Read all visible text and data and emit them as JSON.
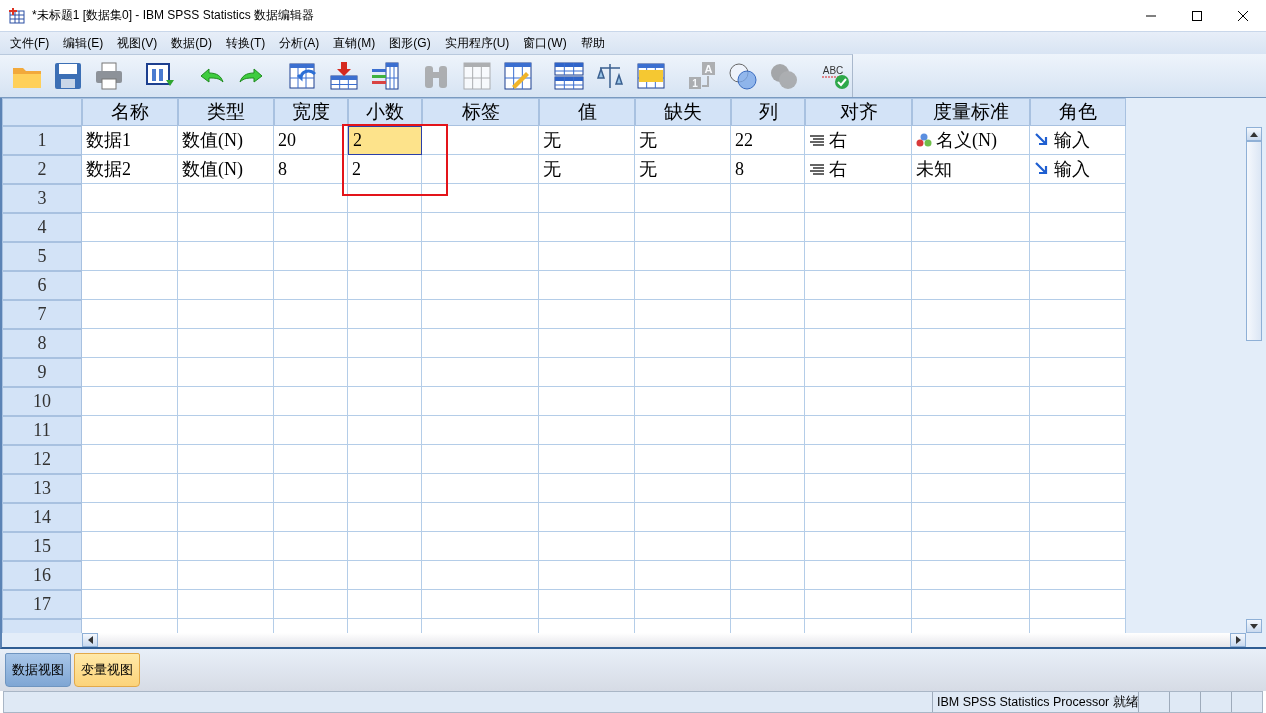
{
  "window": {
    "title": "*未标题1 [数据集0] - IBM SPSS Statistics 数据编辑器"
  },
  "menu": [
    "文件(F)",
    "编辑(E)",
    "视图(V)",
    "数据(D)",
    "转换(T)",
    "分析(A)",
    "直销(M)",
    "图形(G)",
    "实用程序(U)",
    "窗口(W)",
    "帮助"
  ],
  "toolbar": [
    {
      "kind": "open",
      "disabled": false
    },
    {
      "kind": "save",
      "disabled": false
    },
    {
      "kind": "print",
      "disabled": false
    },
    {
      "kind": "dialog",
      "disabled": false
    },
    {
      "kind": "undo",
      "disabled": false
    },
    {
      "kind": "redo",
      "disabled": false
    },
    {
      "kind": "goto",
      "disabled": false
    },
    {
      "kind": "insert",
      "disabled": false
    },
    {
      "kind": "variables",
      "disabled": false
    },
    {
      "kind": "find",
      "disabled": true
    },
    {
      "kind": "table",
      "disabled": true
    },
    {
      "kind": "edit",
      "disabled": false
    },
    {
      "kind": "split",
      "disabled": false
    },
    {
      "kind": "weight",
      "disabled": false
    },
    {
      "kind": "select",
      "disabled": false
    },
    {
      "kind": "labels",
      "disabled": true,
      "labels": [
        "A",
        "1"
      ]
    },
    {
      "kind": "sets",
      "disabled": false
    },
    {
      "kind": "sets",
      "disabled": true
    },
    {
      "kind": "spell",
      "disabled": false,
      "labels": [
        "ABC"
      ]
    }
  ],
  "grid": {
    "columns": [
      "名称",
      "类型",
      "宽度",
      "小数",
      "标签",
      "值",
      "缺失",
      "列",
      "对齐",
      "度量标准",
      "角色"
    ],
    "rows": [
      {
        "number": "1",
        "cells": [
          {
            "text": "数据1",
            "selected": false
          },
          {
            "text": "数值(N)",
            "selected": false
          },
          {
            "text": "20",
            "selected": false
          },
          {
            "text": "2",
            "selected": true
          },
          {
            "selected": false
          },
          {
            "text": "无",
            "selected": false
          },
          {
            "text": "无",
            "selected": false
          },
          {
            "text": "22",
            "selected": false
          },
          {
            "text": "右",
            "kind": "align",
            "selected": false
          },
          {
            "text": "名义(N)",
            "kind": "nominal",
            "selected": false
          },
          {
            "text": "输入",
            "kind": "input",
            "selected": false
          }
        ]
      },
      {
        "number": "2",
        "cells": [
          {
            "text": "数据2",
            "selected": false
          },
          {
            "text": "数值(N)",
            "selected": false
          },
          {
            "text": "8",
            "selected": false
          },
          {
            "text": "2",
            "selected": false
          },
          {
            "selected": false
          },
          {
            "text": "无",
            "selected": false
          },
          {
            "text": "无",
            "selected": false
          },
          {
            "text": "8",
            "selected": false
          },
          {
            "text": "右",
            "kind": "align",
            "selected": false
          },
          {
            "text": "未知",
            "selected": false
          },
          {
            "text": "输入",
            "kind": "input",
            "selected": false
          }
        ]
      },
      {
        "number": "3"
      },
      {
        "number": "4"
      },
      {
        "number": "5"
      },
      {
        "number": "6"
      },
      {
        "number": "7"
      },
      {
        "number": "8"
      },
      {
        "number": "9"
      },
      {
        "number": "10"
      },
      {
        "number": "11"
      },
      {
        "number": "12"
      },
      {
        "number": "13"
      },
      {
        "number": "14"
      },
      {
        "number": "15"
      },
      {
        "number": "16"
      },
      {
        "number": "17"
      }
    ]
  },
  "tabs": [
    {
      "label": "数据视图",
      "selected": false
    },
    {
      "label": "变量视图",
      "selected": true
    }
  ],
  "status_bar": {
    "text": "IBM SPSS Statistics Processor 就绪"
  }
}
